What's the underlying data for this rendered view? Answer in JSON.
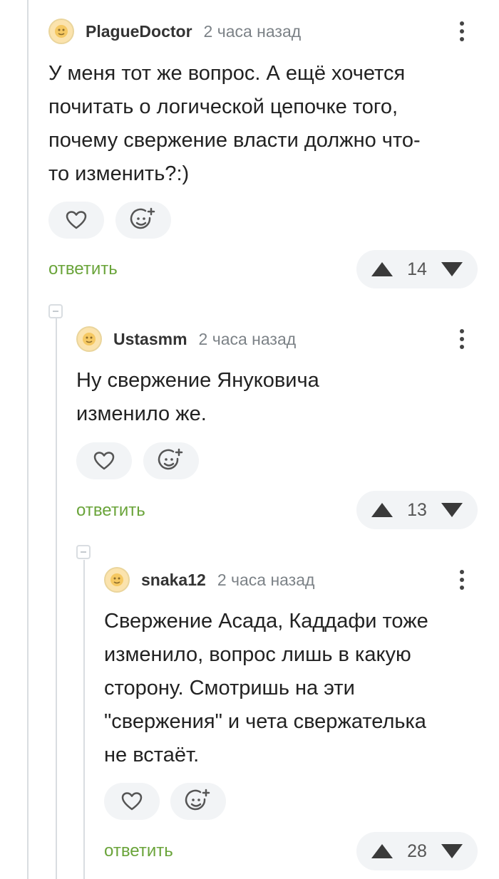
{
  "comments": [
    {
      "author": "PlagueDoctor",
      "time": "2 часа назад",
      "text_lines": [
        "У меня тот же вопрос. А ещё хочется",
        "почитать о логической цепочке того,",
        "почему свержение власти должно что-",
        "то изменить?:)"
      ],
      "reply_label": "ответить",
      "rating": "14"
    },
    {
      "author": "Ustasmm",
      "time": "2 часа назад",
      "text_lines": [
        "Ну свержение Януковича",
        "изменило же."
      ],
      "reply_label": "ответить",
      "rating": "13"
    },
    {
      "author": "snaka12",
      "time": "2 часа назад",
      "text_lines": [
        "Свержение Асада, Каддафи тоже",
        "изменило, вопрос лишь в какую",
        "сторону. Смотришь на эти",
        "\"свержения\" и чета свержателька",
        "не встаёт."
      ],
      "reply_label": "ответить",
      "rating": "28"
    }
  ],
  "icons": {
    "like": "heart-icon",
    "reaction": "add-emoji-icon",
    "upvote": "arrow-up-icon",
    "downvote": "arrow-down-icon",
    "menu": "more-vertical-icon"
  },
  "colors": {
    "accent_green": "#6aa43a",
    "avatar_bg": "#fbe3ad",
    "thread_line": "#d9dde1"
  }
}
